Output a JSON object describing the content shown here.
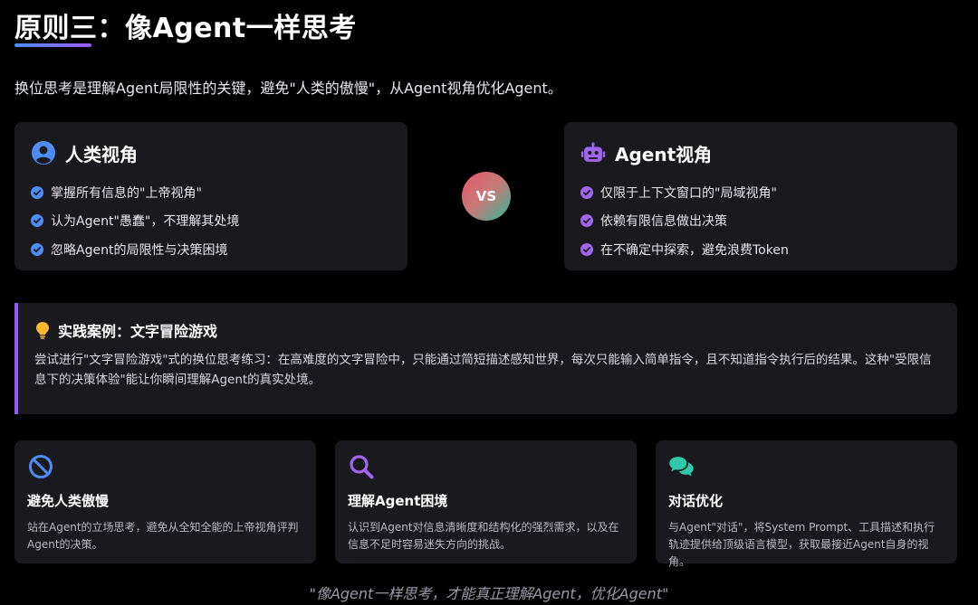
{
  "header": {
    "title": "原则三：像Agent一样思考",
    "subtitle": "换位思考是理解Agent局限性的关键，避免\"人类的傲慢\"，从Agent视角优化Agent。",
    "accent_gradient": [
      "#4c8df6",
      "#9b5cf6"
    ]
  },
  "human_card": {
    "icon": "user-circle-icon",
    "title": "人类视角",
    "icon_color": "#4c8df6",
    "points": [
      "掌握所有信息的\"上帝视角\"",
      "认为Agent\"愚蠢\"，不理解其处境",
      "忽略Agent的局限性与决策困境"
    ]
  },
  "vs_label": "VS",
  "agent_card": {
    "icon": "robot-icon",
    "title": "Agent视角",
    "icon_color": "#a066f0",
    "points": [
      "仅限于上下文窗口的\"局域视角\"",
      "依赖有限信息做出决策",
      "在不确定中探索，避免浪费Token"
    ]
  },
  "case": {
    "icon": "lightbulb-icon",
    "title": "实践案例：文字冒险游戏",
    "body": "尝试进行\"文字冒险游戏\"式的换位思考练习：在高难度的文字冒险中，只能通过简短描述感知世界，每次只能输入简单指令，且不知道指令执行后的结果。这种\"受限信息下的决策体验\"能让你瞬间理解Agent的真实处境。",
    "accent": "#8e5cf0"
  },
  "features": [
    {
      "icon": "ban-icon",
      "icon_color": "#4c8df6",
      "title": "避免人类傲慢",
      "desc": "站在Agent的立场思考，避免从全知全能的上帝视角评判Agent的决策。"
    },
    {
      "icon": "magnifier-icon",
      "icon_color": "#a066f0",
      "title": "理解Agent困境",
      "desc": "认识到Agent对信息清晰度和结构化的强烈需求，以及在信息不足时容易迷失方向的挑战。"
    },
    {
      "icon": "chat-bubbles-icon",
      "icon_color": "#2ec9a8",
      "title": "对话优化",
      "desc": "与Agent\"对话\"，将System Prompt、工具描述和执行轨迹提供给顶级语言模型，获取最接近Agent自身的视角。"
    }
  ],
  "footer_quote": "\"像Agent一样思考，才能真正理解Agent，优化Agent\""
}
